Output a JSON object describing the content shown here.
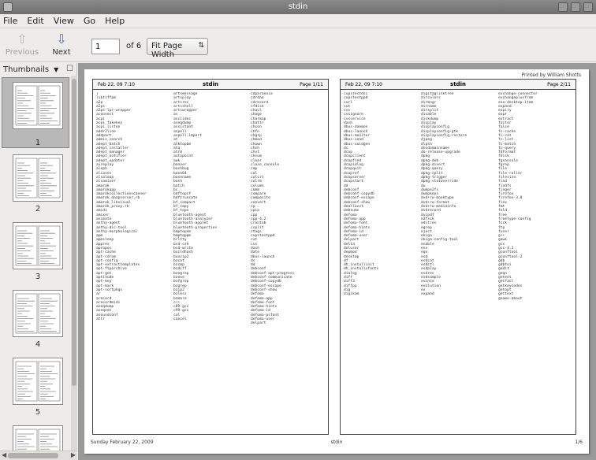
{
  "window": {
    "title": "stdin"
  },
  "menu": {
    "items": [
      "File",
      "Edit",
      "View",
      "Go",
      "Help"
    ]
  },
  "toolbar": {
    "previous_label": "Previous",
    "next_label": "Next",
    "page_value": "1",
    "page_of": "of 6",
    "zoom_value": "Fit Page Width"
  },
  "sidebar": {
    "mode_label": "Thumbnails",
    "thumbnails": [
      {
        "label": "1",
        "selected": true
      },
      {
        "label": "2",
        "selected": false
      },
      {
        "label": "3",
        "selected": false
      },
      {
        "label": "4",
        "selected": false
      },
      {
        "label": "5",
        "selected": false
      }
    ]
  },
  "document": {
    "printed_by": "Printed by William Shotts",
    "left_sheet": {
      "date": "Feb 22, 09 7:10",
      "name": "stdin",
      "page": "Page 1/11"
    },
    "right_sheet": {
      "date": "Feb 22, 09 7:10",
      "name": "stdin",
      "page": "Page 2/11"
    },
    "footer_left": "Sunday February 22, 2009",
    "footer_center": "stdin",
    "footer_right": "1/6",
    "left_columns": [
      "[\nlibtiffpm\na2p\na2ps\na2ps-lpr-wrapper\naconnect\nacpi\nacpi_fakekey\nacpi_listen\naddr2line\naddpart\nadmin_search\nadept_batch\nadept_installer\nadept_manager\nadept_notifier\nadept_updater\naireplay\naleph\naliases\nalsaloop\nalsamixer\namarok\namarokapp\namarokcollectionscanner\namarok_daapserver.rb\namarok_libvisual\namarok_proxy.rb\namidi\namixer\nanimate\nanthy-agent\nanthy-dic-tool\nanthy-morphological\napm\napmsleep\nappres\napropos\napt-cache\napt-cdrom\napt-config\napt-extracttemplates\napt-ftparchive\napt-get\naptitude\napt-key\napt-mark\napt-sortpkgs\nar\narecord\narecordmidi\naseqdump\naseqnet\nasoundconf\nattr",
      "artsmessage\nartsplay\nartsrec\nartsshell\nartswrapper\nas\nasciidoc\naseqdump\nassistant\naspell\naspell-import\nat\natktopbm\natq\natrm\nautopoint\nawk\nbanner\nbashbug\nbase64\nbasename\nbash\nbatch\nbc\nbdftopcf\nbdftruncate\nbf_compact\nbf_copy\nbf_tops\nbluetooth-agent\nbluetooth-analyzer\nbluetooth-applet\nbluetooth-properties\nbmptopnm\nbmptoppm\nbrltty\nbsd-csh\nbsd-write\nbuildhash\nbunzip2\nbzcat\nbzcmp\nbzdiff\nbzegrep\nbzexe\nbzfgrep\nbzgrep\nbzip2\nbzless\nbzmore\nc++\nc89-gcc\nc99-gcc\ncal\ncancel",
      "cdparanoia\ncdrdao\ncdrecord\ncfdisk\nchacl\nchage\ncharmap\nchattr\nchcon\nchfn\nchgrp\nchmod\nchown\nchsh\nchvt\ncksum\nclear\nclose_console\ncmp\ncol\ncolcrt\ncolrm\ncolumn\ncomm\ncompare\ncomposite\nconvert\ncp\ncpio\ncpp\ncpp-4.2\ncrontab\ncsplit\nctags\ncupstestppd\ncut\ncvs\ndash\ndate\ndbus-launch\ndc\ndd\ndebconf\ndebconf-apt-progress\ndebconf-communicate\ndebconf-copydb\ndebconf-escape\ndebconf-show\ndefoma\ndefoma-app\ndefoma-font\ndefoma-hints\ndefoma-id\ndefoma-psfont\ndefoma-user\ndelpart"
    ],
    "right_columns": [
      "cupstestdsc\ncupstestppd\ncurl\ncut\ncvs\ncvsignore\ncvsservice\ndash\ndbus-daemon\ndbus-launch\ndbus-monitor\ndbus-send\ndbus-uuidgen\ndc\ndcop\ndcopclient\ndcopfind\ndcopidlng\ndcopquit\ndcopref\ndcopserver\ndcopstart\ndd\ndebconf\ndebconf-copydb\ndebconf-escape\ndebconf-show\ndeallocvt\ndebsums\ndefoma\ndefoma-app\ndefoma-font\ndefoma-hints\ndefoma-id\ndefoma-user\ndelpart\ndelta\ndeluser\ndepmod\ndesktop\ndf\ndh_installinit\ndh_installxfonts\ndialog\ndiff\ndiff3\ndiffpp\ndig\ndigikam",
      "digitaglinktree\ndircolors\ndirmngr\ndirname\ndirsplit\ndisable\ndiskdump\ndisplay\ndisplayconfig\ndisplayconfig-gtk\ndisplayconfig-restore\ndjpeg\ndlpsh\ndnsdomainname\ndo-release-upgrade\ndpkg\ndpkg-deb\ndpkg-divert\ndpkg-query\ndpkg-split\ndpkg-trigger\ndpkg-statoverride\ndu\ndumpe2fs\ndumpkeys\ndvd+rw-booktype\ndvd+rw-format\ndvd+rw-mediainfo\ndvdrecord\ndvipdf\ne2fsck\neditres\negrep\neject\nekiga\nekiga-config-tool\nenable\nenv\neqn\nesd\nesdcat\nesdctl\nesdplay\nesdrec\nesdsample\nevince\nevolution\nex\nexpand",
      "exchange-connector\nexchangeplusfrom\nexo-desktop-item\nexpand\nexpiry\nexpr\nextract\nfactor\nfalse\nfc-cache\nfc-cat\nfc-list\nfc-match\nfc-query\nfdformat\nfdisk\nfgconsole\nfgrep\nfile\nfile-roller\nfilesize\nfind\nfindfs\nfinger\nfirefox\nfirefox-3.0\nflex\nfmt\nfold\nfree\nfreetype-config\nfsck\nftp\nfuser\ng++\ngawk\ngcc\ngcc-4.2\ngconftool\ngconftool-2\ngdb\ngdbtui\ngedit\ngeqn\ngetent\ngetfacl\ngetkeycodes\ngetopt\ngettext\ngnome-about"
    ]
  }
}
